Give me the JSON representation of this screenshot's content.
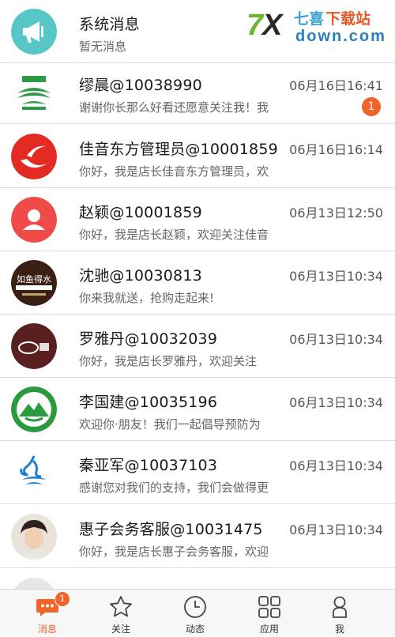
{
  "watermark": {
    "brand": "7X七喜下载站",
    "domain": "down.com"
  },
  "messages": [
    {
      "name": "系统消息",
      "time": "",
      "preview": "暂无消息",
      "badge": "",
      "icon": "megaphone-icon"
    },
    {
      "name": "缪晨@10038990",
      "time": "06月16日16:41",
      "preview": "谢谢你长那么好看还愿意关注我！我",
      "badge": "1",
      "icon": "green-logo"
    },
    {
      "name": "佳音东方管理员@10001859",
      "time": "06月16日16:14",
      "preview": "你好，我是店长佳音东方管理员，欢",
      "badge": "",
      "icon": "red-swoosh-logo"
    },
    {
      "name": "赵颖@10001859",
      "time": "06月13日12:50",
      "preview": "你好，我是店长赵颖，欢迎关注佳音",
      "badge": "",
      "icon": "user-icon"
    },
    {
      "name": "沈驰@10030813",
      "time": "06月13日10:34",
      "preview": "你来我就送，抢购走起来!",
      "badge": "",
      "icon": "ruyujeshui-logo"
    },
    {
      "name": "罗雅丹@10032039",
      "time": "06月13日10:34",
      "preview": "你好，我是店长罗雅丹，欢迎关注",
      "badge": "",
      "icon": "cobu-logo"
    },
    {
      "name": "李国建@10035196",
      "time": "06月13日10:34",
      "preview": "欢迎你·朋友！我们一起倡导预防为",
      "badge": "",
      "icon": "mountain-logo"
    },
    {
      "name": "秦亚军@10037103",
      "time": "06月13日10:34",
      "preview": "感谢您对我们的支持，我们会做得更",
      "badge": "",
      "icon": "water-logo"
    },
    {
      "name": "惠子会务客服@10031475",
      "time": "06月13日10:34",
      "preview": "你好，我是店长惠子会务客服，欢迎",
      "badge": "",
      "icon": "photo-avatar"
    }
  ],
  "tabs": [
    {
      "label": "消息",
      "icon": "chat-icon",
      "badge": "1",
      "active": true
    },
    {
      "label": "关注",
      "icon": "star-icon",
      "badge": "",
      "active": false
    },
    {
      "label": "动态",
      "icon": "clock-icon",
      "badge": "",
      "active": false
    },
    {
      "label": "应用",
      "icon": "grid-icon",
      "badge": "",
      "active": false
    },
    {
      "label": "我",
      "icon": "person-icon",
      "badge": "",
      "active": false
    }
  ],
  "colors": {
    "accent": "#f2632a",
    "system_icon": "#56c6c6",
    "divider": "#dcdcdc"
  }
}
